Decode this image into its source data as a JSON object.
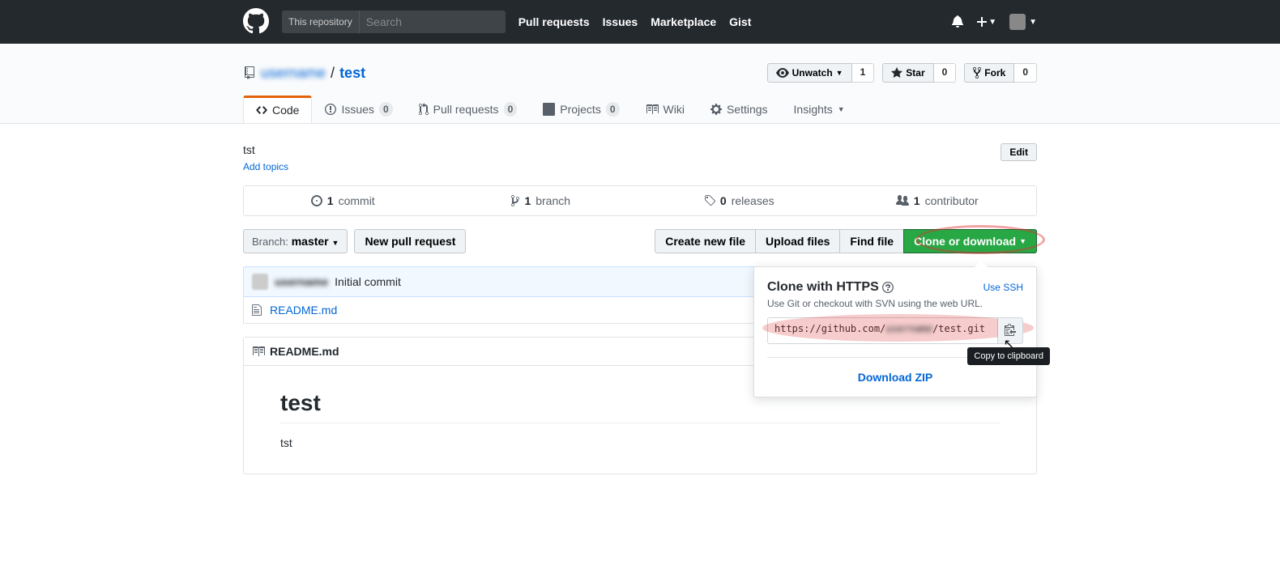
{
  "header": {
    "search_scope": "This repository",
    "search_placeholder": "Search",
    "nav": {
      "pulls": "Pull requests",
      "issues": "Issues",
      "marketplace": "Marketplace",
      "gist": "Gist"
    }
  },
  "repo": {
    "owner": "username",
    "name": "test",
    "description": "tst",
    "add_topics": "Add topics",
    "edit": "Edit",
    "actions": {
      "unwatch": "Unwatch",
      "watch_count": "1",
      "star": "Star",
      "star_count": "0",
      "fork": "Fork",
      "fork_count": "0"
    }
  },
  "tabs": {
    "code": "Code",
    "issues": "Issues",
    "issues_count": "0",
    "pulls": "Pull requests",
    "pulls_count": "0",
    "projects": "Projects",
    "projects_count": "0",
    "wiki": "Wiki",
    "settings": "Settings",
    "insights": "Insights"
  },
  "summary": {
    "commits_n": "1",
    "commits": "commit",
    "branches_n": "1",
    "branches": "branch",
    "releases_n": "0",
    "releases": "releases",
    "contributors_n": "1",
    "contributors": "contributor"
  },
  "filenav": {
    "branch_label": "Branch:",
    "branch_name": "master",
    "new_pr": "New pull request",
    "create_file": "Create new file",
    "upload": "Upload files",
    "find": "Find file",
    "clone": "Clone or download"
  },
  "commit": {
    "author": "username",
    "message": "Initial commit"
  },
  "files": [
    {
      "name": "README.md",
      "msg": "Initial commit"
    }
  ],
  "readme": {
    "filename": "README.md",
    "h1": "test",
    "body": "tst"
  },
  "clone_dropdown": {
    "title": "Clone with HTTPS",
    "use_ssh": "Use SSH",
    "desc": "Use Git or checkout with SVN using the web URL.",
    "url_prefix": "https://github.com/",
    "url_owner": "username",
    "url_suffix": "/test.git",
    "download_zip": "Download ZIP",
    "tooltip": "Copy to clipboard"
  }
}
